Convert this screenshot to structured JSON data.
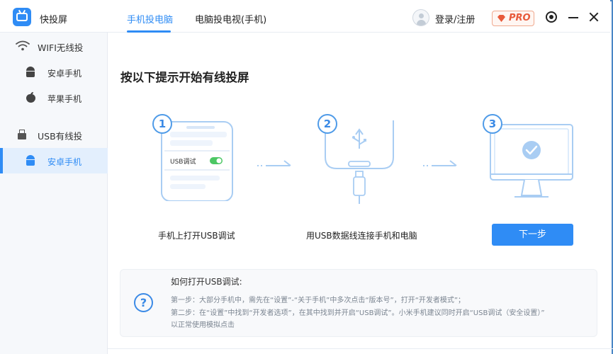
{
  "app": {
    "name": "快投屏"
  },
  "header": {
    "tabs": [
      {
        "label": "手机投电脑",
        "active": true
      },
      {
        "label": "电脑投电视(手机)",
        "active": false
      }
    ],
    "login_label": "登录/注册",
    "pro_label": "PRO"
  },
  "sidebar": {
    "groups": [
      {
        "label": "WIFI无线投",
        "icon": "wifi-icon",
        "items": [
          {
            "label": "安卓手机",
            "icon": "android-icon",
            "active": false
          },
          {
            "label": "苹果手机",
            "icon": "apple-icon",
            "active": false
          }
        ]
      },
      {
        "label": "USB有线投",
        "icon": "usb-icon",
        "items": [
          {
            "label": "安卓手机",
            "icon": "android-icon",
            "active": true
          }
        ]
      }
    ]
  },
  "main": {
    "heading": "按以下提示开始有线投屏",
    "steps": [
      {
        "num": "1",
        "text": "手机上打开USB调试",
        "phone_label": "USB调试"
      },
      {
        "num": "2",
        "text": "用USB数据线连接手机和电脑"
      },
      {
        "num": "3",
        "text": ""
      }
    ],
    "next_label": "下一步"
  },
  "help": {
    "title": "如何打开USB调试:",
    "lines": [
      "第一步：大部分手机中，需先在“设置”-“关于手机”中多次点击“版本号”，打开“开发者模式”；",
      "第二步：在“设置”中找到“开发者选项”，在其中找到并开启“USB调试”。小米手机建议同时开启“USB调试（安全设置）”",
      "以正常使用模拟点击"
    ]
  },
  "colors": {
    "accent": "#2f8cf5",
    "illustration": "#a9cdf3",
    "pro": "#e85a3a",
    "toggle_on": "#4cc764"
  }
}
